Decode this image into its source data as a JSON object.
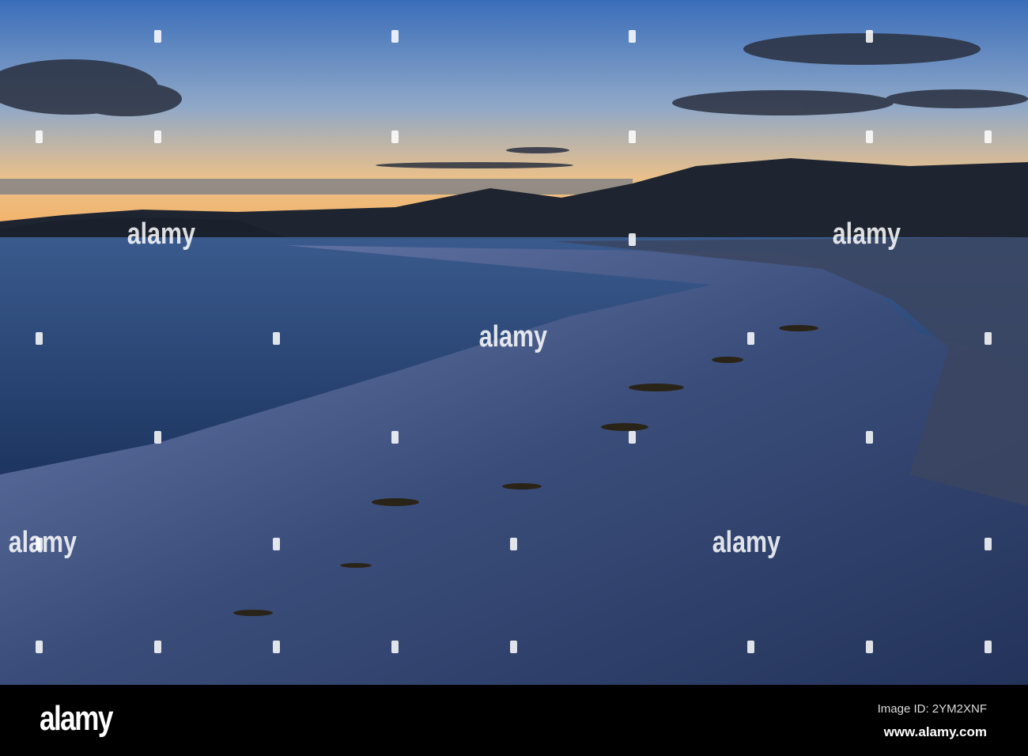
{
  "watermark": {
    "text": "alamy"
  },
  "footer": {
    "logo": "alamy",
    "image_id": "Image ID: 2YM2XNF",
    "url": "www.alamy.com"
  },
  "colors": {
    "sky_top": "#3d6fb8",
    "horizon": "#f4b36a",
    "sea": "#27406e",
    "sand": "#2e3f63"
  }
}
